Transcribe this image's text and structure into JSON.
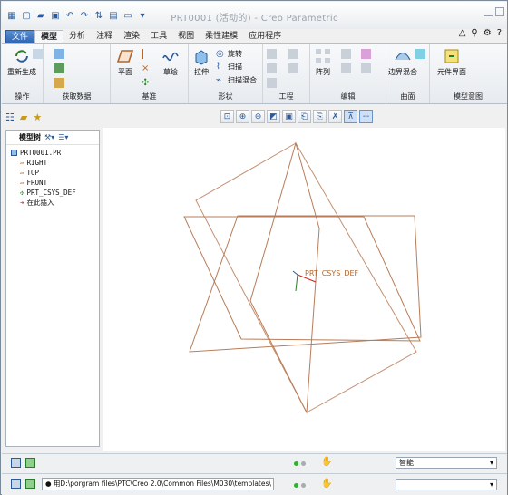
{
  "window": {
    "title": "PRT0001 (活动的) - Creo Parametric"
  },
  "tabs": [
    "文件",
    "模型",
    "分析",
    "注释",
    "渲染",
    "工具",
    "视图",
    "柔性建模",
    "应用程序"
  ],
  "ribbon": {
    "regenerate": "重新生成",
    "plane": "平面",
    "sketch": "草绘",
    "extrude": "拉伸",
    "revolve": "旋转",
    "sweep": "扫描",
    "swept_blend": "扫描混合",
    "pattern": "阵列",
    "boundary_blend": "边界混合",
    "component_interface": "元件界面",
    "groups": {
      "operations": "操作",
      "get_data": "获取数据",
      "datum": "基准",
      "shapes": "形状",
      "engineering": "工程",
      "editing": "编辑",
      "surfaces": "曲面",
      "model_intent": "模型意图"
    }
  },
  "model_tree": {
    "header": "模型树",
    "root": "PRT0001.PRT",
    "items": [
      "RIGHT",
      "TOP",
      "FRONT",
      "PRT_CSYS_DEF",
      "在此插入"
    ]
  },
  "graphics": {
    "csys_label": "PRT_CSYS_DEF"
  },
  "status": {
    "filter": "智能"
  },
  "message": "● 用D:\\porgram files\\PTC\\Creo 2.0\\Common Files\\M030\\templates\\"
}
